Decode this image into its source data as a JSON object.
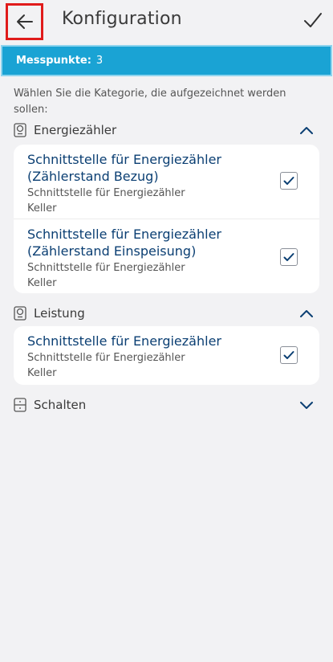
{
  "header": {
    "title": "Konfiguration",
    "back_icon": "arrow-left-icon",
    "confirm_icon": "check-icon"
  },
  "banner": {
    "label": "Messpunkte:",
    "count": "3",
    "color": "#1aa3d4"
  },
  "instructions": "Wählen Sie die Kategorie, die aufgezeichnet werden sollen:",
  "categories": [
    {
      "label": "Energiezähler",
      "icon": "meter-icon",
      "expanded": true,
      "items": [
        {
          "title_line1": "Schnittstelle für Energiezähler",
          "title_line2": "(Zählerstand Bezug)",
          "subtitle": "Schnittstelle für Energiezähler",
          "location": "Keller",
          "checked": true
        },
        {
          "title_line1": "Schnittstelle für Energiezähler",
          "title_line2": "(Zählerstand Einspeisung)",
          "subtitle": "Schnittstelle für Energiezähler",
          "location": "Keller",
          "checked": true
        }
      ]
    },
    {
      "label": "Leistung",
      "icon": "meter-icon",
      "expanded": true,
      "items": [
        {
          "title_line1": "Schnittstelle für Energiezähler",
          "subtitle": "Schnittstelle für Energiezähler",
          "location": "Keller",
          "checked": true
        }
      ]
    },
    {
      "label": "Schalten",
      "icon": "switch-icon",
      "expanded": false
    }
  ]
}
